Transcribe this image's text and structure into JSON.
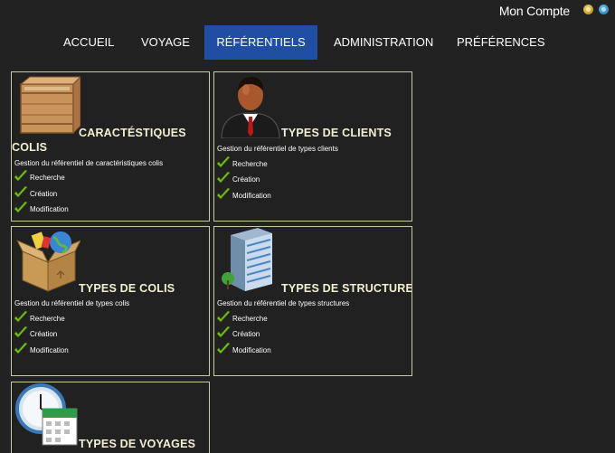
{
  "account": {
    "label": "Mon Compte"
  },
  "nav": {
    "items": [
      {
        "label": "ACCUEIL"
      },
      {
        "label": "VOYAGE"
      },
      {
        "label": "RÉFÉRENTIELS"
      },
      {
        "label": "ADMINISTRATION"
      },
      {
        "label": "PRÉFÉRENCES"
      }
    ],
    "active": "RÉFÉRENTIELS"
  },
  "cards": [
    {
      "title_line1": "CARACTÉSTIQUES",
      "title_line2": "COLIS",
      "description": "Gestion du référentiel de caractéristiques colis",
      "options": [
        "Recherche",
        "Création",
        "Modification"
      ],
      "icon": "crate-icon"
    },
    {
      "title_line1": "TYPES DE CLIENTS",
      "description": "Gestion du référentiel de types clients",
      "options": [
        "Recherche",
        "Création",
        "Modification"
      ],
      "icon": "businessman-icon"
    },
    {
      "title_line1": "TYPES DE COLIS",
      "description": "Gestion du référentiel de types colis",
      "options": [
        "Recherche",
        "Création",
        "Modification"
      ],
      "icon": "package-box-icon"
    },
    {
      "title_line1": "TYPES DE STRUCTURES",
      "description": "Gestion du référentiel de types structures",
      "options": [
        "Recherche",
        "Création",
        "Modification"
      ],
      "icon": "building-icon"
    },
    {
      "title_line1": "TYPES DE VOYAGES",
      "icon": "clock-calendar-icon"
    }
  ],
  "colors": {
    "nav_active": "#1f4ea3",
    "card_border": "#c9c9a4",
    "title": "#f3f0d2",
    "check": "#7bc21d"
  }
}
